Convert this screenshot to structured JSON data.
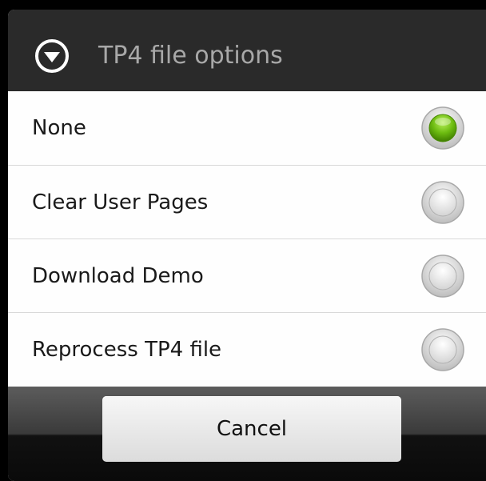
{
  "dialog": {
    "title": "TP4 file options",
    "title_icon": "chevron-down-circle-icon",
    "options": [
      {
        "label": "None",
        "selected": true
      },
      {
        "label": "Clear User Pages",
        "selected": false
      },
      {
        "label": "Download Demo",
        "selected": false
      },
      {
        "label": "Reprocess TP4 file",
        "selected": false
      }
    ],
    "cancel_label": "Cancel"
  },
  "colors": {
    "title_bar_bg": "#2a2a2a",
    "title_text": "#a8a8a8",
    "selected_radio": "#6cbb10",
    "divider": "#d9d9d9"
  }
}
